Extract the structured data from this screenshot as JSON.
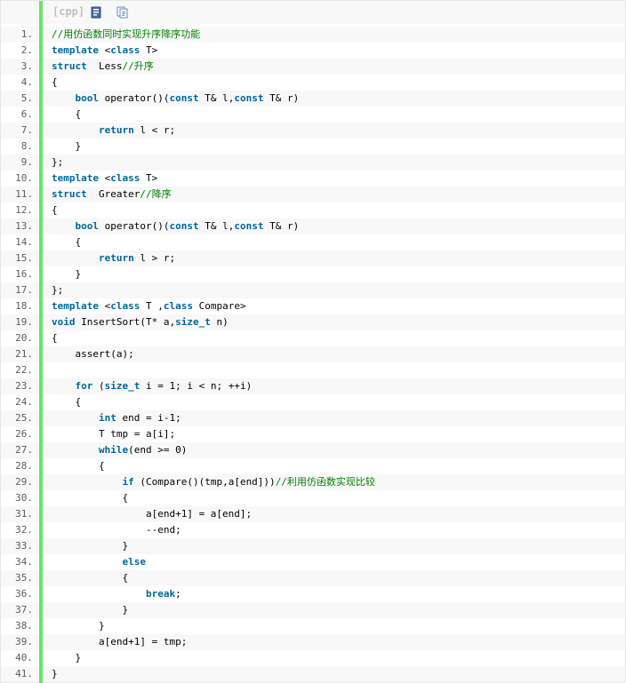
{
  "toolbar": {
    "language": "[cpp]",
    "view_icon": "view-source-icon",
    "copy_icon": "copy-icon"
  },
  "colors": {
    "keyword": "#006699",
    "comment": "#008200",
    "gutter_bar": "#6ce26c",
    "stripe": "#f8f8f8",
    "line_number": "#5c5c5c"
  },
  "lines": [
    {
      "n": "1.",
      "t": [
        {
          "c": "cm",
          "s": "//用仿函数同时实现升序降序功能"
        }
      ]
    },
    {
      "n": "2.",
      "t": [
        {
          "c": "kw",
          "s": "template"
        },
        {
          "s": " <"
        },
        {
          "c": "kw",
          "s": "class"
        },
        {
          "s": " T>"
        }
      ]
    },
    {
      "n": "3.",
      "t": [
        {
          "c": "kw",
          "s": "struct"
        },
        {
          "s": "  Less"
        },
        {
          "c": "cm",
          "s": "//升序"
        }
      ]
    },
    {
      "n": "4.",
      "t": [
        {
          "s": "{"
        }
      ]
    },
    {
      "n": "5.",
      "t": [
        {
          "s": "    "
        },
        {
          "c": "kw",
          "s": "bool"
        },
        {
          "s": " operator()("
        },
        {
          "c": "kw",
          "s": "const"
        },
        {
          "s": " T& l,"
        },
        {
          "c": "kw",
          "s": "const"
        },
        {
          "s": " T& r)"
        }
      ]
    },
    {
      "n": "6.",
      "t": [
        {
          "s": "    {"
        }
      ]
    },
    {
      "n": "7.",
      "t": [
        {
          "s": "        "
        },
        {
          "c": "kw",
          "s": "return"
        },
        {
          "s": " l < r;"
        }
      ]
    },
    {
      "n": "8.",
      "t": [
        {
          "s": "    }"
        }
      ]
    },
    {
      "n": "9.",
      "t": [
        {
          "s": "};"
        }
      ]
    },
    {
      "n": "10.",
      "t": [
        {
          "c": "kw",
          "s": "template"
        },
        {
          "s": " <"
        },
        {
          "c": "kw",
          "s": "class"
        },
        {
          "s": " T>"
        }
      ]
    },
    {
      "n": "11.",
      "t": [
        {
          "c": "kw",
          "s": "struct"
        },
        {
          "s": "  Greater"
        },
        {
          "c": "cm",
          "s": "//降序"
        }
      ]
    },
    {
      "n": "12.",
      "t": [
        {
          "s": "{"
        }
      ]
    },
    {
      "n": "13.",
      "t": [
        {
          "s": "    "
        },
        {
          "c": "kw",
          "s": "bool"
        },
        {
          "s": " operator()("
        },
        {
          "c": "kw",
          "s": "const"
        },
        {
          "s": " T& l,"
        },
        {
          "c": "kw",
          "s": "const"
        },
        {
          "s": " T& r)"
        }
      ]
    },
    {
      "n": "14.",
      "t": [
        {
          "s": "    {"
        }
      ]
    },
    {
      "n": "15.",
      "t": [
        {
          "s": "        "
        },
        {
          "c": "kw",
          "s": "return"
        },
        {
          "s": " l > r;"
        }
      ]
    },
    {
      "n": "16.",
      "t": [
        {
          "s": "    }"
        }
      ]
    },
    {
      "n": "17.",
      "t": [
        {
          "s": "};"
        }
      ]
    },
    {
      "n": "18.",
      "t": [
        {
          "c": "kw",
          "s": "template"
        },
        {
          "s": " <"
        },
        {
          "c": "kw",
          "s": "class"
        },
        {
          "s": " T ,"
        },
        {
          "c": "kw",
          "s": "class"
        },
        {
          "s": " Compare>"
        }
      ]
    },
    {
      "n": "19.",
      "t": [
        {
          "c": "kw",
          "s": "void"
        },
        {
          "s": " InsertSort(T* a,"
        },
        {
          "c": "kw",
          "s": "size_t"
        },
        {
          "s": " n)"
        }
      ]
    },
    {
      "n": "20.",
      "t": [
        {
          "s": "{"
        }
      ]
    },
    {
      "n": "21.",
      "t": [
        {
          "s": "    assert(a);"
        }
      ]
    },
    {
      "n": "22.",
      "t": [
        {
          "s": " "
        }
      ]
    },
    {
      "n": "23.",
      "t": [
        {
          "s": "    "
        },
        {
          "c": "kw",
          "s": "for"
        },
        {
          "s": " ("
        },
        {
          "c": "kw",
          "s": "size_t"
        },
        {
          "s": " i = 1; i < n; ++i)"
        }
      ]
    },
    {
      "n": "24.",
      "t": [
        {
          "s": "    {"
        }
      ]
    },
    {
      "n": "25.",
      "t": [
        {
          "s": "        "
        },
        {
          "c": "kw",
          "s": "int"
        },
        {
          "s": " end = i-1;"
        }
      ]
    },
    {
      "n": "26.",
      "t": [
        {
          "s": "        T tmp = a[i];"
        }
      ]
    },
    {
      "n": "27.",
      "t": [
        {
          "s": "        "
        },
        {
          "c": "kw",
          "s": "while"
        },
        {
          "s": "(end >= 0)"
        }
      ]
    },
    {
      "n": "28.",
      "t": [
        {
          "s": "        {"
        }
      ]
    },
    {
      "n": "29.",
      "t": [
        {
          "s": "            "
        },
        {
          "c": "kw",
          "s": "if"
        },
        {
          "s": " (Compare()(tmp,a[end]))"
        },
        {
          "c": "cm",
          "s": "//利用仿函数实现比较"
        }
      ]
    },
    {
      "n": "30.",
      "t": [
        {
          "s": "            {"
        }
      ]
    },
    {
      "n": "31.",
      "t": [
        {
          "s": "                a[end+1] = a[end];"
        }
      ]
    },
    {
      "n": "32.",
      "t": [
        {
          "s": "                --end;"
        }
      ]
    },
    {
      "n": "33.",
      "t": [
        {
          "s": "            }"
        }
      ]
    },
    {
      "n": "34.",
      "t": [
        {
          "s": "            "
        },
        {
          "c": "kw",
          "s": "else"
        }
      ]
    },
    {
      "n": "35.",
      "t": [
        {
          "s": "            {"
        }
      ]
    },
    {
      "n": "36.",
      "t": [
        {
          "s": "                "
        },
        {
          "c": "kw",
          "s": "break"
        },
        {
          "s": ";"
        }
      ]
    },
    {
      "n": "37.",
      "t": [
        {
          "s": "            }"
        }
      ]
    },
    {
      "n": "38.",
      "t": [
        {
          "s": "        }"
        }
      ]
    },
    {
      "n": "39.",
      "t": [
        {
          "s": "        a[end+1] = tmp;"
        }
      ]
    },
    {
      "n": "40.",
      "t": [
        {
          "s": "    }"
        }
      ]
    },
    {
      "n": "41.",
      "t": [
        {
          "s": "}"
        }
      ]
    }
  ]
}
